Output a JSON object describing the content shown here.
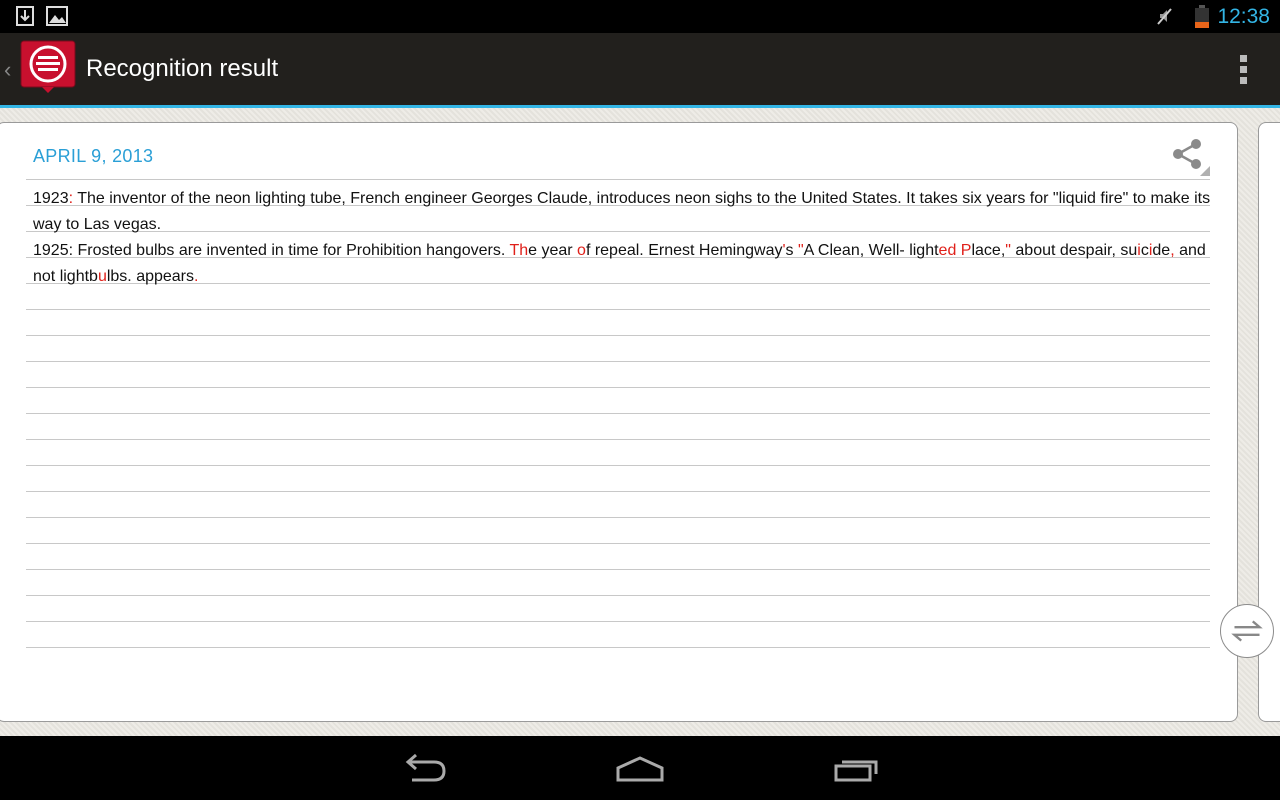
{
  "status_bar": {
    "time": "12:38",
    "icons": [
      "download-icon",
      "image-icon",
      "mute-icon",
      "battery-low-icon"
    ],
    "battery_color": "#e8651a",
    "time_color": "#33b5e5"
  },
  "action_bar": {
    "title": "Recognition result",
    "logo_color": "#c8102e",
    "icons": [
      "up-chevron-icon",
      "app-logo-icon",
      "overflow-menu-icon"
    ]
  },
  "card": {
    "date": "APRIL 9, 2013",
    "share_icon": "share-icon",
    "paragraphs": [
      [
        {
          "t": "1923",
          "e": false
        },
        {
          "t": ":",
          "e": true
        },
        {
          "t": " The inventor of the neon lighting tube, French engineer Georges Claude, introduces neon sighs to the United States. It takes six years for \"liquid fire\" to make its way to Las vegas.",
          "e": false
        }
      ],
      [
        {
          "t": "1925: Frosted bulbs are invented in time for Prohibition hangovers. ",
          "e": false
        },
        {
          "t": "Th",
          "e": true
        },
        {
          "t": "e year ",
          "e": false
        },
        {
          "t": "o",
          "e": true
        },
        {
          "t": "f repeal. Ernest Hemingway",
          "e": false
        },
        {
          "t": "'",
          "e": true
        },
        {
          "t": "s ",
          "e": false
        },
        {
          "t": "\"",
          "e": true
        },
        {
          "t": "A Clean, Well- light",
          "e": false
        },
        {
          "t": "ed P",
          "e": true
        },
        {
          "t": "lace,",
          "e": false
        },
        {
          "t": "\"",
          "e": true
        },
        {
          "t": " about despair, su",
          "e": false
        },
        {
          "t": "i",
          "e": true
        },
        {
          "t": "c",
          "e": false
        },
        {
          "t": "i",
          "e": true
        },
        {
          "t": "de",
          "e": false
        },
        {
          "t": ",",
          "e": true
        },
        {
          "t": " and not lightb",
          "e": false
        },
        {
          "t": "u",
          "e": true
        },
        {
          "t": "lbs. appears",
          "e": false
        },
        {
          "t": ".",
          "e": true
        }
      ]
    ],
    "error_color": "#e0201a",
    "accent_color": "#2a9fd6"
  },
  "swap_button": {
    "icon": "swap-arrows-icon"
  },
  "nav_bar": {
    "buttons": [
      "back-icon",
      "home-icon",
      "recent-apps-icon"
    ]
  }
}
